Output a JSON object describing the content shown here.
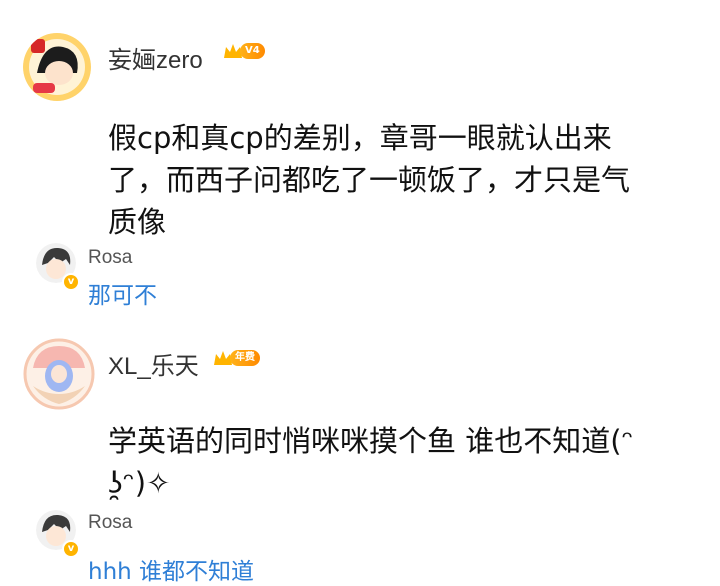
{
  "comments": [
    {
      "username": "妄婳zero",
      "level": "V4",
      "text_lines": [
        "假cp和真cp的差别，章哥一眼就认出来",
        "了，而西子问都吃了一顿饭了，才只是气",
        "质像"
      ],
      "reply": {
        "name": "Rosa",
        "text": "那可不"
      }
    },
    {
      "username": "XL_乐天",
      "level": "年费",
      "text_lines": [
        "学英语的同时悄咪咪摸个鱼 谁也不知道(ᵔ",
        "ʖ̯ᵔ)✧"
      ],
      "reply": {
        "name": "Rosa",
        "text": "hhh 谁都不知道"
      }
    }
  ],
  "colors": {
    "reply_link": "#2f7fd6",
    "vip_gold": "#ffb400"
  }
}
